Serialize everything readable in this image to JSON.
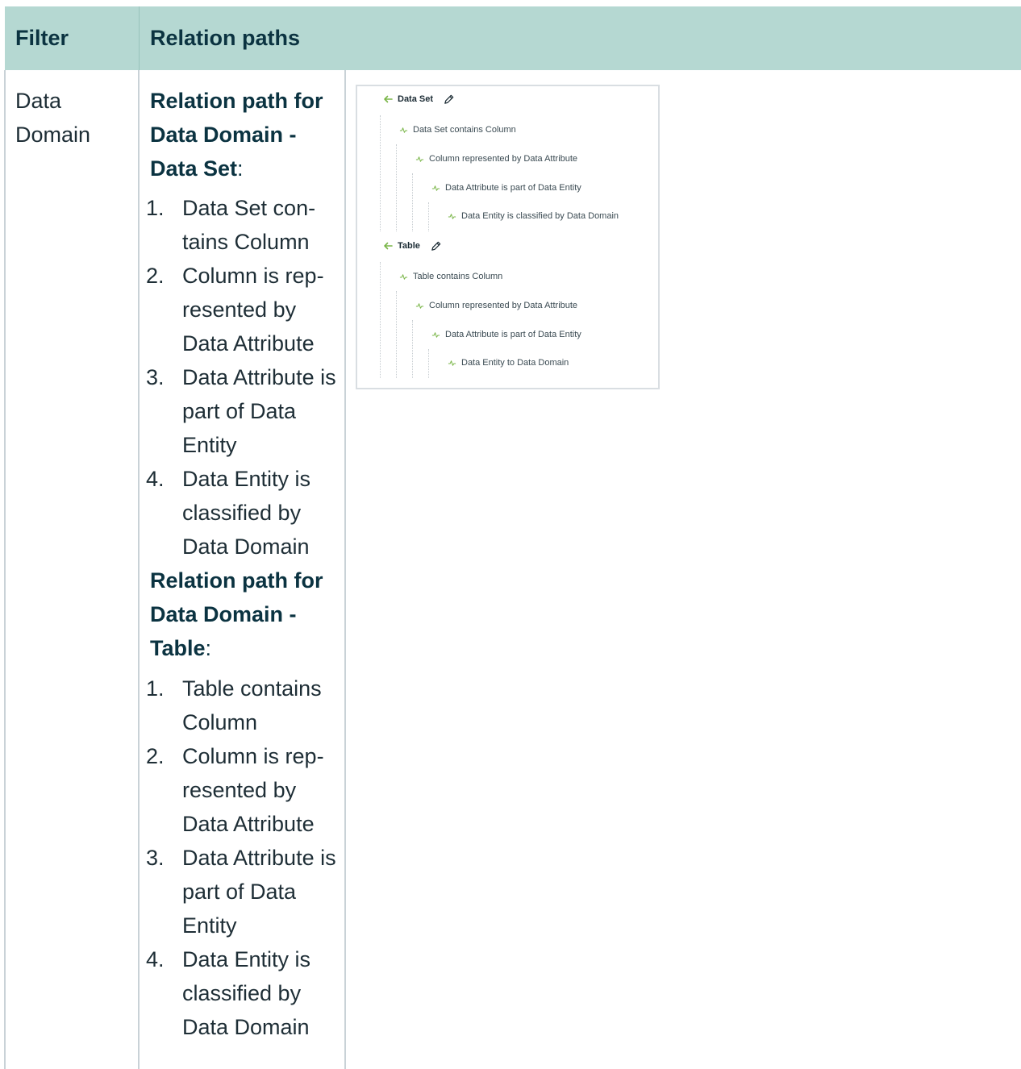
{
  "header": {
    "filter": "Filter",
    "relation_paths": "Relation paths"
  },
  "row": {
    "filter_value": "Data Domain",
    "sections": [
      {
        "title": "Relation path for Data Domain - Data Set",
        "colon": ":",
        "steps": [
          {
            "num": "1.",
            "text": "Data Set con­tains Column"
          },
          {
            "num": "2.",
            "text": "Column is rep­resented by Data Attribute"
          },
          {
            "num": "3.",
            "text": "Data Attribute is part of Data Entity"
          },
          {
            "num": "4.",
            "text": "Data Entity is classified by Data Domain"
          }
        ]
      },
      {
        "title": "Relation path for Data Domain - Table",
        "colon": ":",
        "steps": [
          {
            "num": "1.",
            "text": "Table contains Column"
          },
          {
            "num": "2.",
            "text": "Column is rep­resented by Data Attribute"
          },
          {
            "num": "3.",
            "text": "Data Attribute is part of Data Entity"
          },
          {
            "num": "4.",
            "text": "Data Entity is classified by Data Domain"
          }
        ]
      }
    ]
  },
  "screenshot": {
    "accent": "#7ab648",
    "groups": [
      {
        "title": "Data Set",
        "relations": [
          "Data Set contains Column",
          "Column represented by Data Attribute",
          "Data Attribute is part of Data Entity",
          "Data Entity is classified by Data Domain"
        ]
      },
      {
        "title": "Table",
        "relations": [
          "Table contains Column",
          "Column represented by Data Attribute",
          "Data Attribute is part of Data Entity",
          "Data Entity to Data Domain"
        ]
      }
    ]
  }
}
